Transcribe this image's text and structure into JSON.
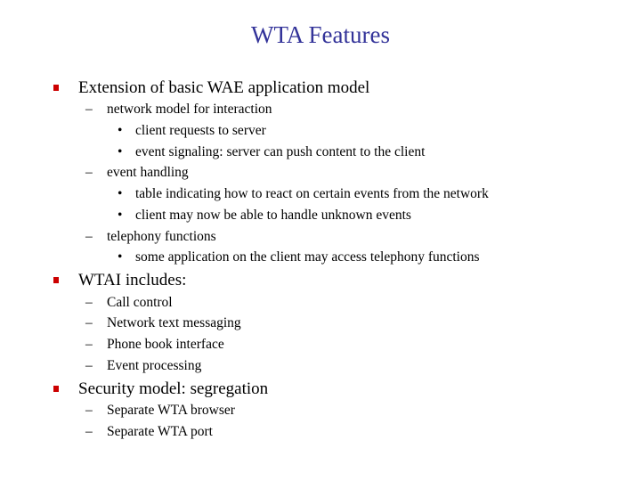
{
  "title": "WTA Features",
  "bullets": [
    {
      "text": "Extension of basic WAE application model"
    },
    {
      "text": "WTAI includes:"
    },
    {
      "text": "Security model: segregation"
    }
  ],
  "sub": {
    "b1": [
      {
        "text": "network model for interaction",
        "items": [
          "client requests to server",
          "event signaling: server can push content to the client"
        ]
      },
      {
        "text": "event handling",
        "items": [
          "table indicating how to react on certain events from the network",
          "client may now be able to handle unknown events"
        ]
      },
      {
        "text": "telephony functions",
        "items": [
          "some application on the client may access telephony functions"
        ]
      }
    ],
    "b2": [
      "Call control",
      "Network text messaging",
      "Phone book interface",
      "Event processing"
    ],
    "b3": [
      "Separate WTA browser",
      "Separate WTA port"
    ]
  },
  "glyphs": {
    "dash": "–",
    "dot": "•"
  }
}
